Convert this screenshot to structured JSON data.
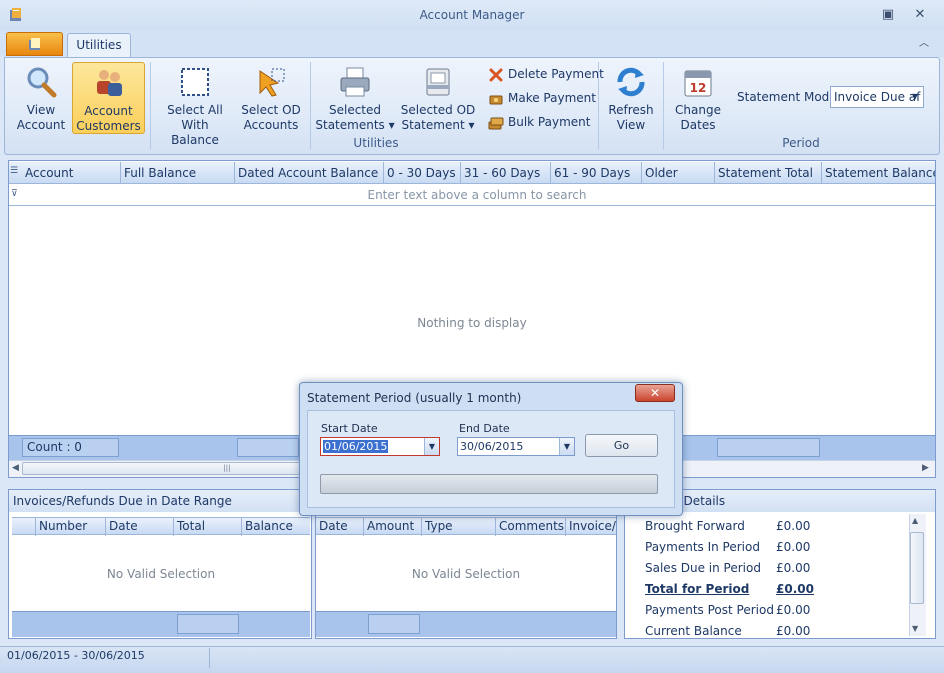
{
  "window": {
    "title": "Account Manager"
  },
  "tabs": {
    "utilities": "Utilities"
  },
  "ribbon": {
    "view_account": "View\nAccount",
    "account_customers": "Account\nCustomers",
    "select_all": "Select All\nWith Balance",
    "select_od": "Select OD\nAccounts",
    "selected_statements": "Selected\nStatements ▾",
    "selected_od_statement": "Selected OD\nStatement ▾",
    "delete_payment": "Delete Payment",
    "make_payment": "Make Payment",
    "bulk_payment": "Bulk Payment",
    "refresh_view": "Refresh\nView",
    "change_dates": "Change\nDates",
    "utilities_group": "Utilities",
    "period_group": "Period",
    "statement_mode_label": "Statement Mode",
    "statement_mode_value": "Invoice Due af"
  },
  "grid": {
    "columns": [
      "Account",
      "Full Balance",
      "Dated Account Balance",
      "0 - 30 Days",
      "31 - 60 Days",
      "61 - 90 Days",
      "Older",
      "Statement Total",
      "Statement Balance"
    ],
    "filter_placeholder": "Enter text above a column to search",
    "empty": "Nothing to display",
    "count": "Count : 0"
  },
  "invoices_panel": {
    "title": "Invoices/Refunds Due in Date Range",
    "columns": [
      "Number",
      "Date",
      "Total",
      "Balance"
    ],
    "empty": "No Valid Selection"
  },
  "payments_panel": {
    "columns": [
      "Date",
      "Amount",
      "Type",
      "Comments",
      "Invoice/"
    ],
    "empty": "No Valid Selection"
  },
  "details_panel": {
    "title": "t Details",
    "rows": [
      {
        "label": "Brought Forward",
        "value": "£0.00"
      },
      {
        "label": "Payments In Period",
        "value": "£0.00"
      },
      {
        "label": "Sales Due in Period",
        "value": "£0.00"
      },
      {
        "label": "Total for Period",
        "value": "£0.00"
      },
      {
        "label": "Payments Post Period",
        "value": "£0.00"
      },
      {
        "label": "Current Balance",
        "value": "£0.00"
      }
    ]
  },
  "dialog": {
    "title": "Statement Period (usually 1 month)",
    "start_label": "Start Date",
    "start_value": "01/06/2015",
    "end_label": "End Date",
    "end_value": "30/06/2015",
    "go": "Go",
    "close": "✕"
  },
  "status": {
    "range": "01/06/2015 - 30/06/2015"
  },
  "colors": {
    "accent": "#fbcf5a",
    "header": "#c8daf3",
    "footer": "#a8c4ec"
  }
}
